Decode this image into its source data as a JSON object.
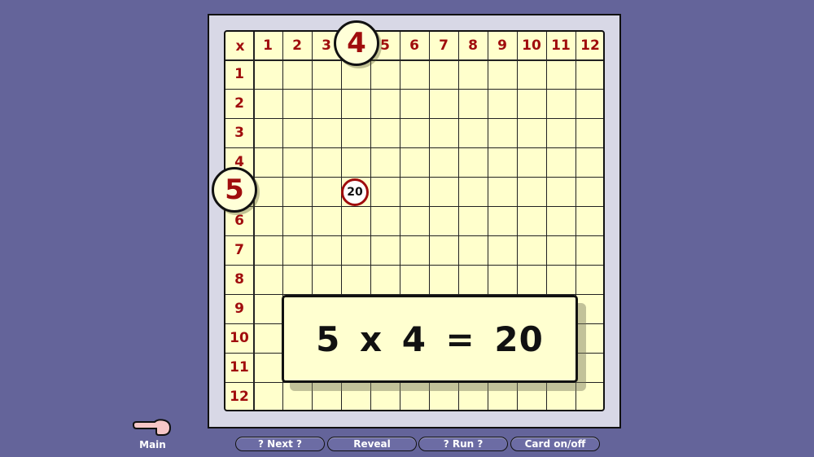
{
  "board": {
    "corner_label": "x",
    "column_headers": [
      "1",
      "2",
      "3",
      "4",
      "5",
      "6",
      "7",
      "8",
      "9",
      "10",
      "11",
      "12"
    ],
    "row_headers": [
      "1",
      "2",
      "3",
      "4",
      "5",
      "6",
      "7",
      "8",
      "9",
      "10",
      "11",
      "12"
    ],
    "selected_column": "4",
    "selected_row": "5",
    "selected_cell_value": "20",
    "colors": {
      "header_text": "#a00d0d",
      "grid_fill": "#ffffcc",
      "background": "#64649a"
    }
  },
  "card": {
    "equation": "5 x 4 = 20"
  },
  "controls": {
    "main_label": "Main",
    "next_label": "? Next ?",
    "reveal_label": "Reveal",
    "run_label": "? Run ?",
    "card_toggle_label": "Card on/off"
  }
}
